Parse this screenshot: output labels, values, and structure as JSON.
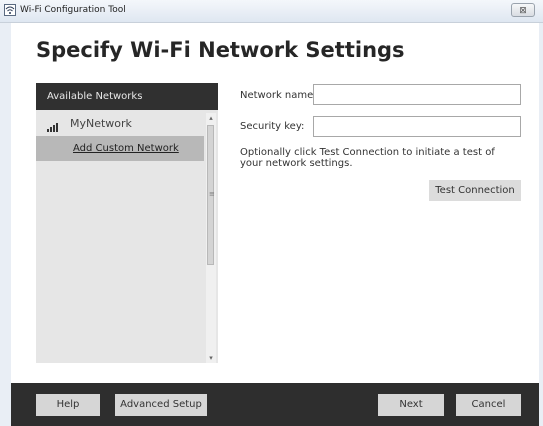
{
  "window": {
    "title": "Wi-Fi Configuration Tool",
    "close_glyph": "⊠"
  },
  "page": {
    "heading": "Specify Wi-Fi Network Settings"
  },
  "networks": {
    "header": "Available Networks",
    "items": [
      {
        "label": "MyNetwork",
        "icon": "wifi-signal-bars-icon"
      }
    ],
    "add_custom_label": "Add Custom Network"
  },
  "form": {
    "network_name_label": "Network name:",
    "network_name_value": "",
    "security_key_label": "Security key:",
    "security_key_value": "",
    "hint": "Optionally click Test Connection to initiate a test of your network settings.",
    "test_button": "Test Connection"
  },
  "footer": {
    "help": "Help",
    "advanced_setup": "Advanced Setup",
    "next": "Next",
    "cancel": "Cancel"
  },
  "colors": {
    "footer_bg": "#2e2e2e",
    "header_bg": "#303030",
    "panel_bg": "#e6e6e6",
    "selected_bg": "#b8b8b8"
  }
}
